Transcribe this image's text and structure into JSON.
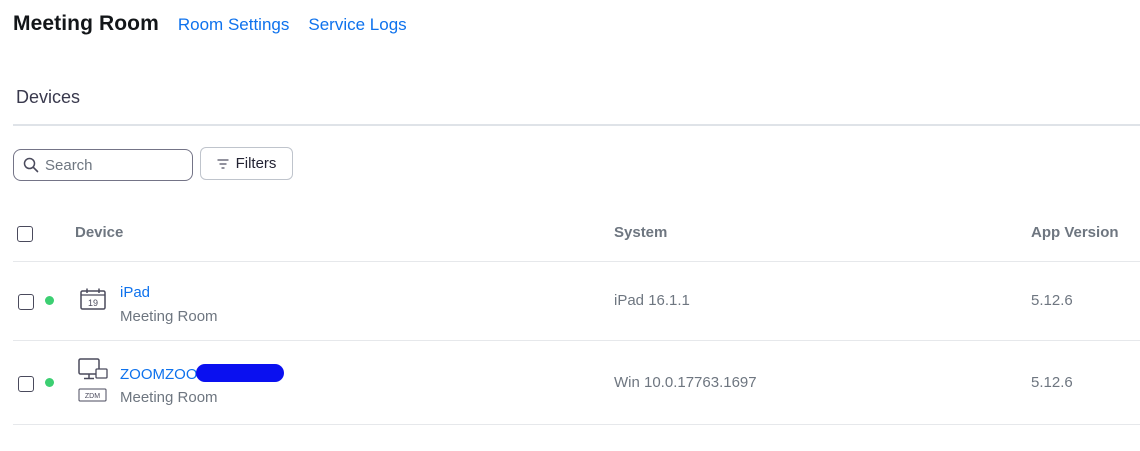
{
  "header": {
    "title": "Meeting Room",
    "links": [
      "Room Settings",
      "Service Logs"
    ]
  },
  "section": {
    "title": "Devices"
  },
  "toolbar": {
    "search_placeholder": "Search",
    "filters_label": "Filters"
  },
  "table": {
    "columns": [
      "Device",
      "System",
      "App Version"
    ],
    "rows": [
      {
        "name": "iPad",
        "type": "Meeting Room",
        "system": "iPad 16.1.1",
        "app_version": "5.12.6",
        "status": "online",
        "icon": "calendar-icon",
        "icon_text": "19"
      },
      {
        "name": "ZOOMZOO",
        "type": "Meeting Room",
        "system": "Win 10.0.17763.1697",
        "app_version": "5.12.6",
        "status": "online",
        "icon": "monitor-icon",
        "icon_text": "ZDM"
      }
    ]
  },
  "colors": {
    "link": "#0e72ed",
    "status_online": "#3ccf72",
    "redaction": "#0a10f0"
  }
}
